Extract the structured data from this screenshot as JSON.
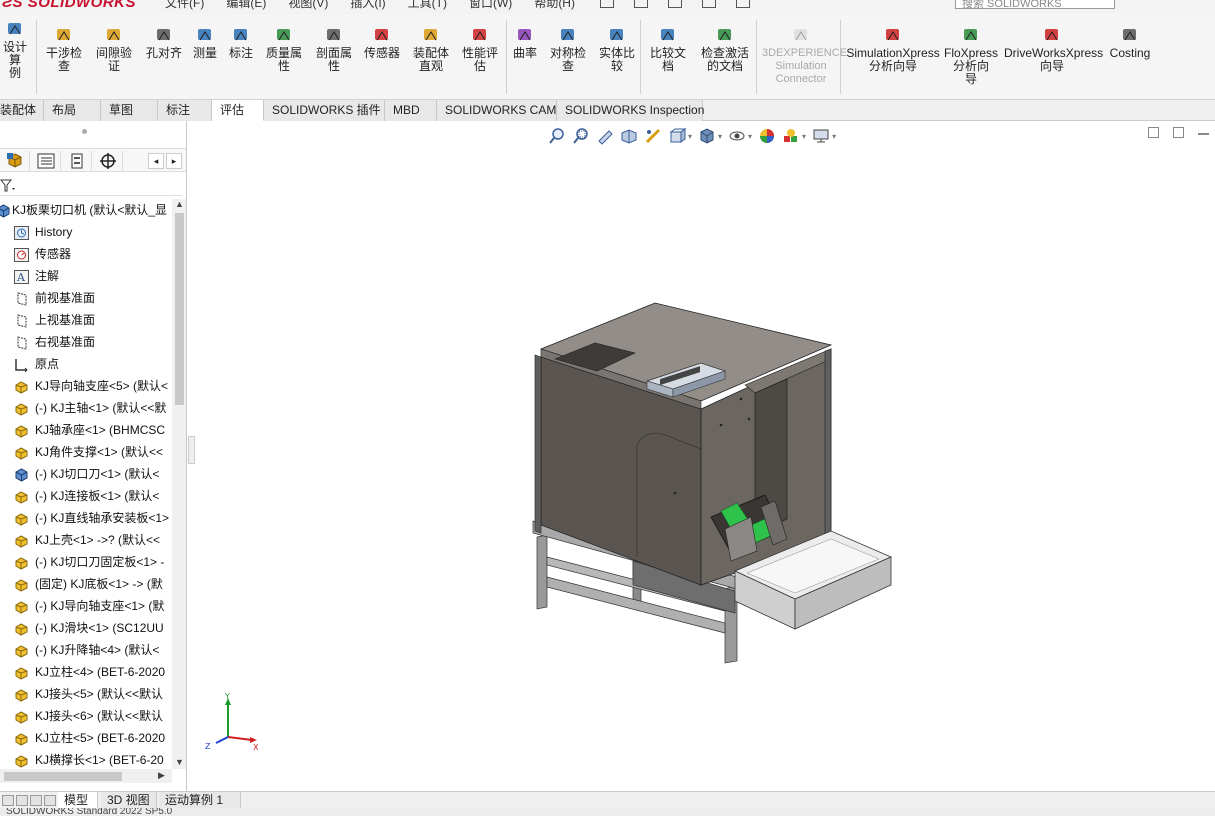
{
  "app": {
    "brand": "SOLIDWORKS",
    "search_placeholder": "搜索 SOLIDWORKS",
    "menu": [
      "文件(F)",
      "编辑(E)",
      "视图(V)",
      "插入(I)",
      "工具(T)",
      "窗口(W)",
      "帮助(H)"
    ]
  },
  "ribbon": {
    "buttons": [
      {
        "label": "设计算\n例",
        "icon": "design-study-icon",
        "color": "#2a6fb5"
      },
      {
        "label": "干涉检\n查",
        "icon": "interference-check-icon",
        "color": "#d89b12"
      },
      {
        "label": "间隙验\n证",
        "icon": "clearance-verify-icon",
        "color": "#d89b12"
      },
      {
        "label": "孔对齐",
        "icon": "hole-align-icon",
        "color": "#555555"
      },
      {
        "label": "测量",
        "icon": "measure-icon",
        "color": "#2a6fb5"
      },
      {
        "label": "标注",
        "icon": "markup-icon",
        "color": "#2a6fb5"
      },
      {
        "label": "质量属\n性",
        "icon": "mass-properties-icon",
        "color": "#2a8a3a"
      },
      {
        "label": "剖面属\n性",
        "icon": "section-properties-icon",
        "color": "#555555"
      },
      {
        "label": "传感器",
        "icon": "sensor-icon",
        "color": "#cc2222"
      },
      {
        "label": "装配体\n直观",
        "icon": "assembly-visualization-icon",
        "color": "#d89b12"
      },
      {
        "label": "性能评\n估",
        "icon": "performance-evaluation-icon",
        "color": "#cc2222"
      },
      {
        "label": "曲率",
        "icon": "curvature-icon",
        "color": "#8a3ab5"
      },
      {
        "label": "对称检\n查",
        "icon": "symmetry-check-icon",
        "color": "#2a6fb5"
      },
      {
        "label": "实体比\n较",
        "icon": "body-compare-icon",
        "color": "#2a6fb5"
      },
      {
        "label": "比较文\n档",
        "icon": "compare-documents-icon",
        "color": "#2a6fb5"
      },
      {
        "label": "检查激活\n的文档",
        "icon": "check-active-document-icon",
        "color": "#2a8a3a"
      },
      {
        "label": "3DEXPERIENCE\nSimulation\nConnector",
        "icon": "3dexperience-icon",
        "color": "#bbbbbb"
      },
      {
        "label": "SimulationXpress\n分析向导",
        "icon": "simulationxpress-icon",
        "color": "#cc2222"
      },
      {
        "label": "FloXpress\n分析向\n导",
        "icon": "floxpress-icon",
        "color": "#2a8a3a"
      },
      {
        "label": "DriveWorksXpress\n向导",
        "icon": "driveworksxpress-icon",
        "color": "#cc2222"
      },
      {
        "label": "Costing",
        "icon": "costing-icon",
        "color": "#555555"
      }
    ]
  },
  "tabs": [
    "装配体",
    "布局",
    "草图",
    "标注",
    "评估",
    "SOLIDWORKS 插件",
    "MBD",
    "SOLIDWORKS CAM",
    "SOLIDWORKS Inspection"
  ],
  "active_tab": "评估",
  "tree": {
    "root": "KJ板栗切口机  (默认<默认_显",
    "items": [
      {
        "label": "History",
        "icon": "history-icon"
      },
      {
        "label": "传感器",
        "icon": "sensor-folder-icon"
      },
      {
        "label": "注解",
        "icon": "annotations-icon"
      },
      {
        "label": "前视基准面",
        "icon": "plane-icon"
      },
      {
        "label": "上视基准面",
        "icon": "plane-icon"
      },
      {
        "label": "右视基准面",
        "icon": "plane-icon"
      },
      {
        "label": "原点",
        "icon": "origin-icon"
      },
      {
        "label": "KJ导向轴支座<5> (默认<",
        "icon": "part-icon"
      },
      {
        "label": "(-) KJ主轴<1> (默认<<默",
        "icon": "part-icon"
      },
      {
        "label": "KJ轴承座<1> (BHMCSC",
        "icon": "part-icon"
      },
      {
        "label": "KJ角件支撑<1> (默认<<",
        "icon": "part-icon"
      },
      {
        "label": "(-) KJ切口刀<1> (默认<",
        "icon": "assembly-icon"
      },
      {
        "label": "(-) KJ连接板<1> (默认<",
        "icon": "part-icon"
      },
      {
        "label": "(-) KJ直线轴承安装板<1>",
        "icon": "part-icon"
      },
      {
        "label": "KJ上壳<1> ->? (默认<<",
        "icon": "part-icon"
      },
      {
        "label": "(-) KJ切口刀固定板<1> -",
        "icon": "part-icon"
      },
      {
        "label": "(固定) KJ底板<1> -> (默",
        "icon": "part-icon"
      },
      {
        "label": "(-) KJ导向轴支座<1> (默",
        "icon": "part-icon"
      },
      {
        "label": "(-) KJ滑块<1> (SC12UU",
        "icon": "part-icon"
      },
      {
        "label": "(-) KJ升降轴<4> (默认<",
        "icon": "part-icon"
      },
      {
        "label": "KJ立柱<4> (BET-6-2020",
        "icon": "part-icon"
      },
      {
        "label": "KJ接头<5> (默认<<默认",
        "icon": "part-icon"
      },
      {
        "label": "KJ接头<6> (默认<<默认",
        "icon": "part-icon"
      },
      {
        "label": "KJ立柱<5> (BET-6-2020",
        "icon": "part-icon"
      },
      {
        "label": "KJ横撑长<1> (BET-6-20",
        "icon": "part-icon"
      }
    ]
  },
  "triad": {
    "x": "X",
    "y": "Y",
    "z": "Z"
  },
  "bottom_tabs": [
    "模型",
    "3D 视图",
    "运动算例 1"
  ],
  "active_bottom_tab": "模型",
  "status": "SOLIDWORKS Standard 2022 SP5.0"
}
